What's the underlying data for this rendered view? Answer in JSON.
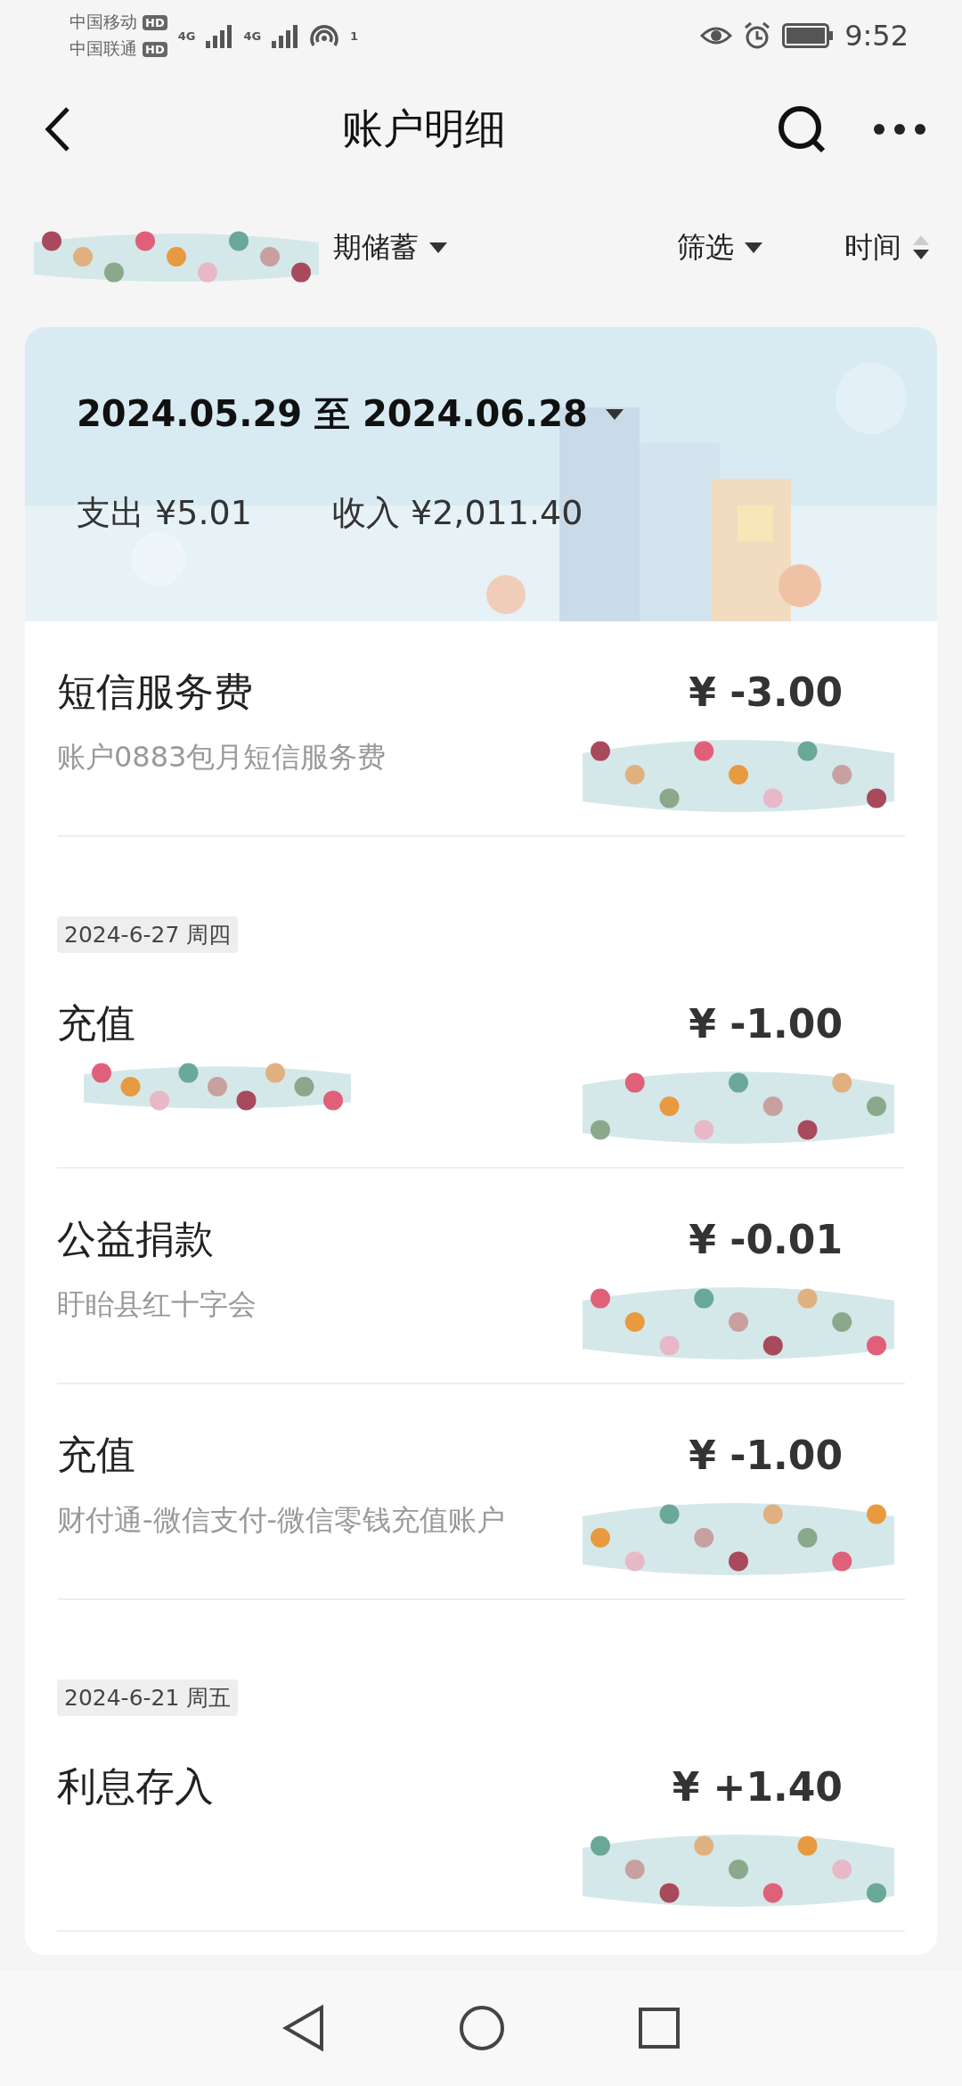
{
  "status_bar": {
    "carriers": [
      {
        "name": "中国移动",
        "badge": "HD"
      },
      {
        "name": "中国联通",
        "badge": "HD"
      }
    ],
    "networks": [
      "4G",
      "4G"
    ],
    "hotspot_count": "1",
    "time": "9:52"
  },
  "header": {
    "title": "账户明细"
  },
  "filters": {
    "account_type": "期储蓄",
    "filter": "筛选",
    "sort": "时间"
  },
  "summary": {
    "date_range": "2024.05.29 至 2024.06.28",
    "expense_label": "支出",
    "expense": "¥5.01",
    "income_label": "收入",
    "income": "¥2,011.40"
  },
  "entries": [
    {
      "kind": "transaction",
      "title": "短信服务费",
      "amount": "¥ -3.00",
      "subtitle": "账户0883包月短信服务费",
      "subtitle_hidden": false
    },
    {
      "kind": "date",
      "label": "2024-6-27 周四"
    },
    {
      "kind": "transaction",
      "title": "充值",
      "amount": "¥ -1.00",
      "subtitle_hidden": true
    },
    {
      "kind": "transaction",
      "title": "公益捐款",
      "amount": "¥ -0.01",
      "subtitle": "盱眙县红十字会",
      "subtitle_hidden": false
    },
    {
      "kind": "transaction",
      "title": "充值",
      "amount": "¥ -1.00",
      "subtitle": "财付通-微信支付-微信零钱充值账户",
      "subtitle_hidden": false
    },
    {
      "kind": "date",
      "label": "2024-6-21 周五"
    },
    {
      "kind": "transaction",
      "title": "利息存入",
      "amount": "¥ +1.40",
      "subtitle_hidden": false
    }
  ]
}
